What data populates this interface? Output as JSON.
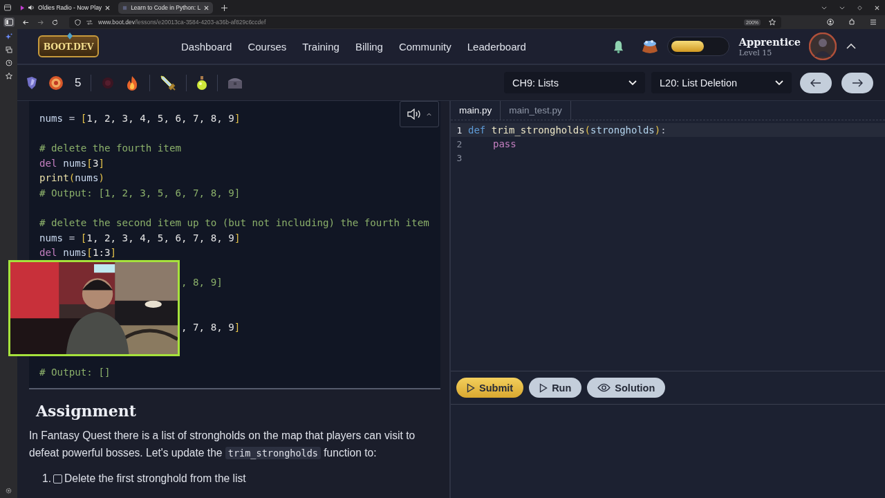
{
  "browser": {
    "tabs": [
      {
        "title": "Oldies Radio - Now Play",
        "selected": false,
        "audio": true
      },
      {
        "title": "Learn to Code in Python: L",
        "selected": true,
        "audio": false
      }
    ],
    "address": {
      "domain": "www.boot.dev",
      "path": "/lessons/e20013ca-3584-4203-a36b-af829c6ccdef",
      "zoom": "200%"
    }
  },
  "nav": {
    "logo": "BOOT.DEV",
    "links": [
      "Dashboard",
      "Courses",
      "Training",
      "Billing",
      "Community",
      "Leaderboard"
    ],
    "xp": {
      "level": 0.6
    },
    "rank": "Apprentice",
    "level": "Level 15"
  },
  "toolbar": {
    "count": "5",
    "chapter": "CH9: Lists",
    "lesson": "L20: List Deletion"
  },
  "lesson": {
    "code": [
      {
        "kind": "code",
        "tokens": [
          {
            "kind": "var",
            "t": "nums"
          },
          {
            "kind": "op",
            "t": " = "
          },
          {
            "kind": "bracket",
            "t": "["
          },
          {
            "kind": "num",
            "t": "1, 2, 3, 4, 5, 6, 7, 8, 9"
          },
          {
            "kind": "bracket",
            "t": "]"
          }
        ]
      },
      {
        "kind": "blank"
      },
      {
        "kind": "code",
        "tokens": [
          {
            "kind": "comment",
            "t": "# delete the fourth item"
          }
        ]
      },
      {
        "kind": "code",
        "tokens": [
          {
            "kind": "kw",
            "t": "del"
          },
          {
            "kind": "var",
            "t": " nums"
          },
          {
            "kind": "bracket",
            "t": "["
          },
          {
            "kind": "num",
            "t": "3"
          },
          {
            "kind": "bracket",
            "t": "]"
          }
        ]
      },
      {
        "kind": "code",
        "tokens": [
          {
            "kind": "func",
            "t": "print"
          },
          {
            "kind": "bracket",
            "t": "("
          },
          {
            "kind": "var",
            "t": "nums"
          },
          {
            "kind": "bracket",
            "t": ")"
          }
        ]
      },
      {
        "kind": "code",
        "tokens": [
          {
            "kind": "comment",
            "t": "# Output: [1, 2, 3, 5, 6, 7, 8, 9]"
          }
        ]
      },
      {
        "kind": "blank"
      },
      {
        "kind": "code",
        "tokens": [
          {
            "kind": "comment",
            "t": "# delete the second item up to (but not including) the fourth item"
          }
        ]
      },
      {
        "kind": "code",
        "tokens": [
          {
            "kind": "var",
            "t": "nums"
          },
          {
            "kind": "op",
            "t": " = "
          },
          {
            "kind": "bracket",
            "t": "["
          },
          {
            "kind": "num",
            "t": "1, 2, 3, 4, 5, 6, 7, 8, 9"
          },
          {
            "kind": "bracket",
            "t": "]"
          }
        ]
      },
      {
        "kind": "code",
        "tokens": [
          {
            "kind": "kw",
            "t": "del"
          },
          {
            "kind": "var",
            "t": " nums"
          },
          {
            "kind": "bracket",
            "t": "["
          },
          {
            "kind": "num",
            "t": "1:3"
          },
          {
            "kind": "bracket",
            "t": "]"
          }
        ]
      },
      {
        "kind": "blank"
      },
      {
        "kind": "partial",
        "tokens": [
          {
            "kind": "comment",
            "t": ", 8, 9]"
          }
        ]
      },
      {
        "kind": "blank"
      },
      {
        "kind": "blank"
      },
      {
        "kind": "partial",
        "tokens": [
          {
            "kind": "num",
            "t": ", 7, 8, 9"
          },
          {
            "kind": "bracket",
            "t": "]"
          }
        ]
      },
      {
        "kind": "blank"
      },
      {
        "kind": "blank"
      },
      {
        "kind": "code",
        "tokens": [
          {
            "kind": "comment",
            "t": "# Output: []"
          }
        ]
      }
    ],
    "heading": "Assignment",
    "paragraph": {
      "before": "In Fantasy Quest there is a list of strongholds on the map that players can visit to defeat powerful bosses. Let's update the ",
      "code": "trim_strongholds",
      "after": " function to:"
    },
    "steps": [
      {
        "number": "1.",
        "text": "Delete the first stronghold from the list",
        "checked": false
      }
    ]
  },
  "editor": {
    "tabs": [
      {
        "label": "main.py",
        "selected": true
      },
      {
        "label": "main_test.py",
        "selected": false
      }
    ],
    "lines": [
      {
        "number": "1",
        "kind": "code",
        "current": true,
        "tokens": [
          {
            "kind": "def",
            "t": "def"
          },
          {
            "kind": "name",
            "t": " trim_strongholds"
          },
          {
            "kind": "bracket",
            "t": "("
          },
          {
            "kind": "param",
            "t": "strongholds"
          },
          {
            "kind": "bracket",
            "t": ")"
          },
          {
            "kind": "op",
            "t": ":"
          }
        ]
      },
      {
        "number": "2",
        "kind": "indented",
        "current": false,
        "tokens": [
          {
            "kind": "kw",
            "t": "pass"
          }
        ]
      },
      {
        "number": "3",
        "kind": "empty",
        "current": false
      }
    ],
    "buttons": [
      {
        "label": "Submit",
        "kind": "submit"
      },
      {
        "label": "Run",
        "kind": "run"
      },
      {
        "label": "Solution",
        "kind": "solution"
      }
    ]
  }
}
